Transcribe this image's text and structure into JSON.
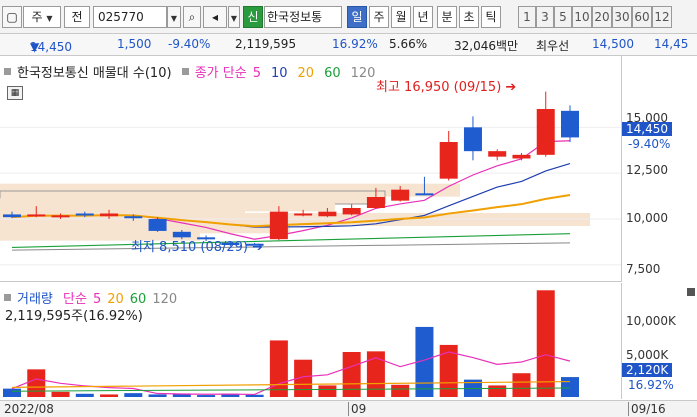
{
  "toolbar": {
    "type_label": "주",
    "prev_label": "전",
    "code_value": "025770",
    "search_icon": "magnifier-icon",
    "sound_icon": "speaker-icon",
    "new_badge": "신",
    "stock_name": "한국정보통",
    "periods": [
      "일",
      "주",
      "월",
      "년",
      "분",
      "초",
      "틱"
    ],
    "active_period": "일",
    "minute_options": [
      "1",
      "3",
      "5",
      "10",
      "20",
      "30",
      "60",
      "12"
    ]
  },
  "quote": {
    "price": "14,450",
    "change": "1,500",
    "change_pct": "-9.40%",
    "volume": "2,119,595",
    "turnover_pct": "16.92%",
    "extra_pct": "5.66%",
    "trade_value": "32,046백만",
    "best_ask_label": "최우선",
    "best_ask": "14,500",
    "best_bid": "14,45"
  },
  "price_panel": {
    "legend_name": "한국정보통신 매물대 수(10)",
    "ma_label": "종가 단순",
    "ma_periods": [
      "5",
      "10",
      "20",
      "60",
      "120"
    ],
    "high_label": "최고 16,950 (09/15)",
    "low_label": "최저 8,510 (08/29)",
    "y_ticks": [
      "15,000",
      "12,500",
      "10,000",
      "7,500"
    ],
    "current_price_tag": "14,450",
    "current_pct_tag": "-9.40%"
  },
  "volume_panel": {
    "legend_name": "거래량",
    "ma_label": "단순",
    "ma_periods": [
      "5",
      "20",
      "60",
      "120"
    ],
    "value_label": "2,119,595주(16.92%)",
    "y_ticks": [
      "10,000K",
      "5,000K"
    ],
    "current_tag": "2,120K",
    "pct_tag": "16.92%"
  },
  "dates": {
    "left": "2022/08",
    "mid": "09",
    "right": "09/16"
  },
  "colors": {
    "up": "#e8251c",
    "down": "#1e5ccf",
    "ma5": "#e830b8",
    "ma10": "#1f3fb0",
    "ma20": "#f0a000",
    "ma60": "#1aa03a",
    "ma120": "#888888",
    "volume_profile": "#f6e3d0"
  },
  "chart_data": {
    "type": "candlestick",
    "candles": [
      {
        "o": 10250,
        "h": 10400,
        "l": 10050,
        "c": 10100
      },
      {
        "o": 10200,
        "h": 10700,
        "l": 10100,
        "c": 10250
      },
      {
        "o": 10150,
        "h": 10300,
        "l": 10000,
        "c": 10200
      },
      {
        "o": 10300,
        "h": 10400,
        "l": 10100,
        "c": 10200
      },
      {
        "o": 10150,
        "h": 10500,
        "l": 10000,
        "c": 10300
      },
      {
        "o": 10150,
        "h": 10250,
        "l": 9900,
        "c": 10100
      },
      {
        "o": 10000,
        "h": 10100,
        "l": 9300,
        "c": 9350
      },
      {
        "o": 9300,
        "h": 9400,
        "l": 8900,
        "c": 9000
      },
      {
        "o": 9000,
        "h": 9100,
        "l": 8800,
        "c": 8950
      },
      {
        "o": 8700,
        "h": 8800,
        "l": 8510,
        "c": 8580
      },
      {
        "o": 8650,
        "h": 8700,
        "l": 8550,
        "c": 8600
      },
      {
        "o": 8900,
        "h": 10700,
        "l": 8850,
        "c": 10400
      },
      {
        "o": 10200,
        "h": 10500,
        "l": 10150,
        "c": 10300
      },
      {
        "o": 10150,
        "h": 10600,
        "l": 10100,
        "c": 10400
      },
      {
        "o": 10250,
        "h": 10800,
        "l": 10200,
        "c": 10600
      },
      {
        "o": 10600,
        "h": 11700,
        "l": 10550,
        "c": 11200
      },
      {
        "o": 11000,
        "h": 11800,
        "l": 10950,
        "c": 11600
      },
      {
        "o": 11400,
        "h": 12300,
        "l": 11300,
        "c": 11300
      },
      {
        "o": 12200,
        "h": 14800,
        "l": 12100,
        "c": 14200
      },
      {
        "o": 15000,
        "h": 15600,
        "l": 13200,
        "c": 13700
      },
      {
        "o": 13400,
        "h": 13800,
        "l": 13200,
        "c": 13700
      },
      {
        "o": 13300,
        "h": 13600,
        "l": 13200,
        "c": 13500
      },
      {
        "o": 13500,
        "h": 16950,
        "l": 13400,
        "c": 16000
      },
      {
        "o": 15900,
        "h": 16200,
        "l": 14200,
        "c": 14450
      }
    ],
    "volumes_k": [
      1300,
      4300,
      800,
      500,
      400,
      600,
      400,
      450,
      300,
      500,
      350,
      8800,
      5800,
      1800,
      7000,
      7100,
      1900,
      10900,
      8100,
      2700,
      1800,
      3700,
      16600,
      3100
    ],
    "price_range": [
      7000,
      17800
    ],
    "volume_range": [
      0,
      14000
    ]
  }
}
